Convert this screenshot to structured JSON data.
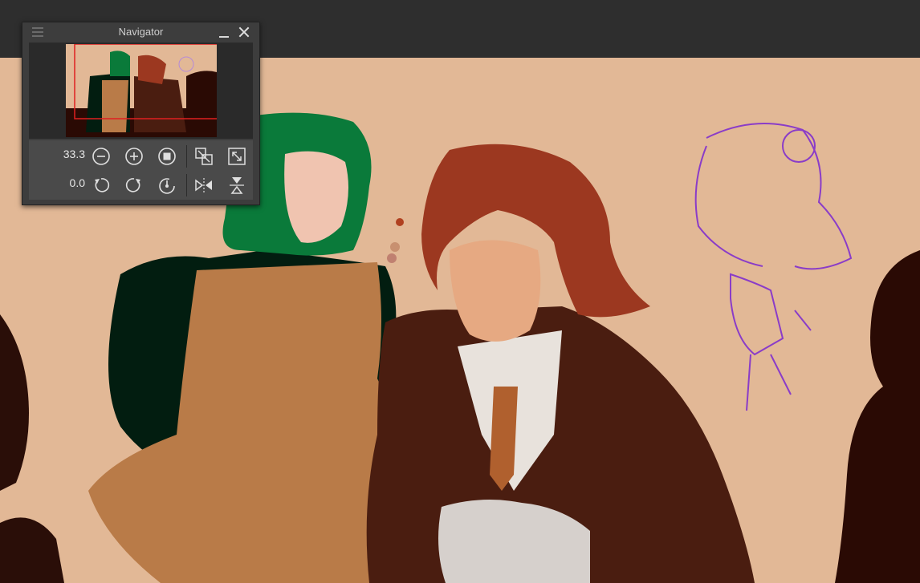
{
  "navigator": {
    "title": "Navigator",
    "zoom_value": "33.3",
    "rotation_value": "0.0",
    "icons": {
      "menu": "hamburger-menu-icon",
      "minimize": "minimize-icon",
      "close": "close-icon",
      "zoom_out": "zoom-out-minus-icon",
      "zoom_in": "zoom-in-plus-icon",
      "stop": "stop-icon",
      "fit_window": "fit-to-window-icon",
      "actual_size": "actual-size-icon",
      "rotate_left": "rotate-left-icon",
      "rotate_right": "rotate-right-icon",
      "reset_rotation": "reset-rotation-icon",
      "flip_horizontal": "flip-horizontal-icon",
      "flip_vertical": "flip-vertical-icon"
    }
  },
  "colors": {
    "canvas_background": "#e2b896",
    "panel_background": "#3d3d3d",
    "viewport_frame": "#e02020"
  }
}
